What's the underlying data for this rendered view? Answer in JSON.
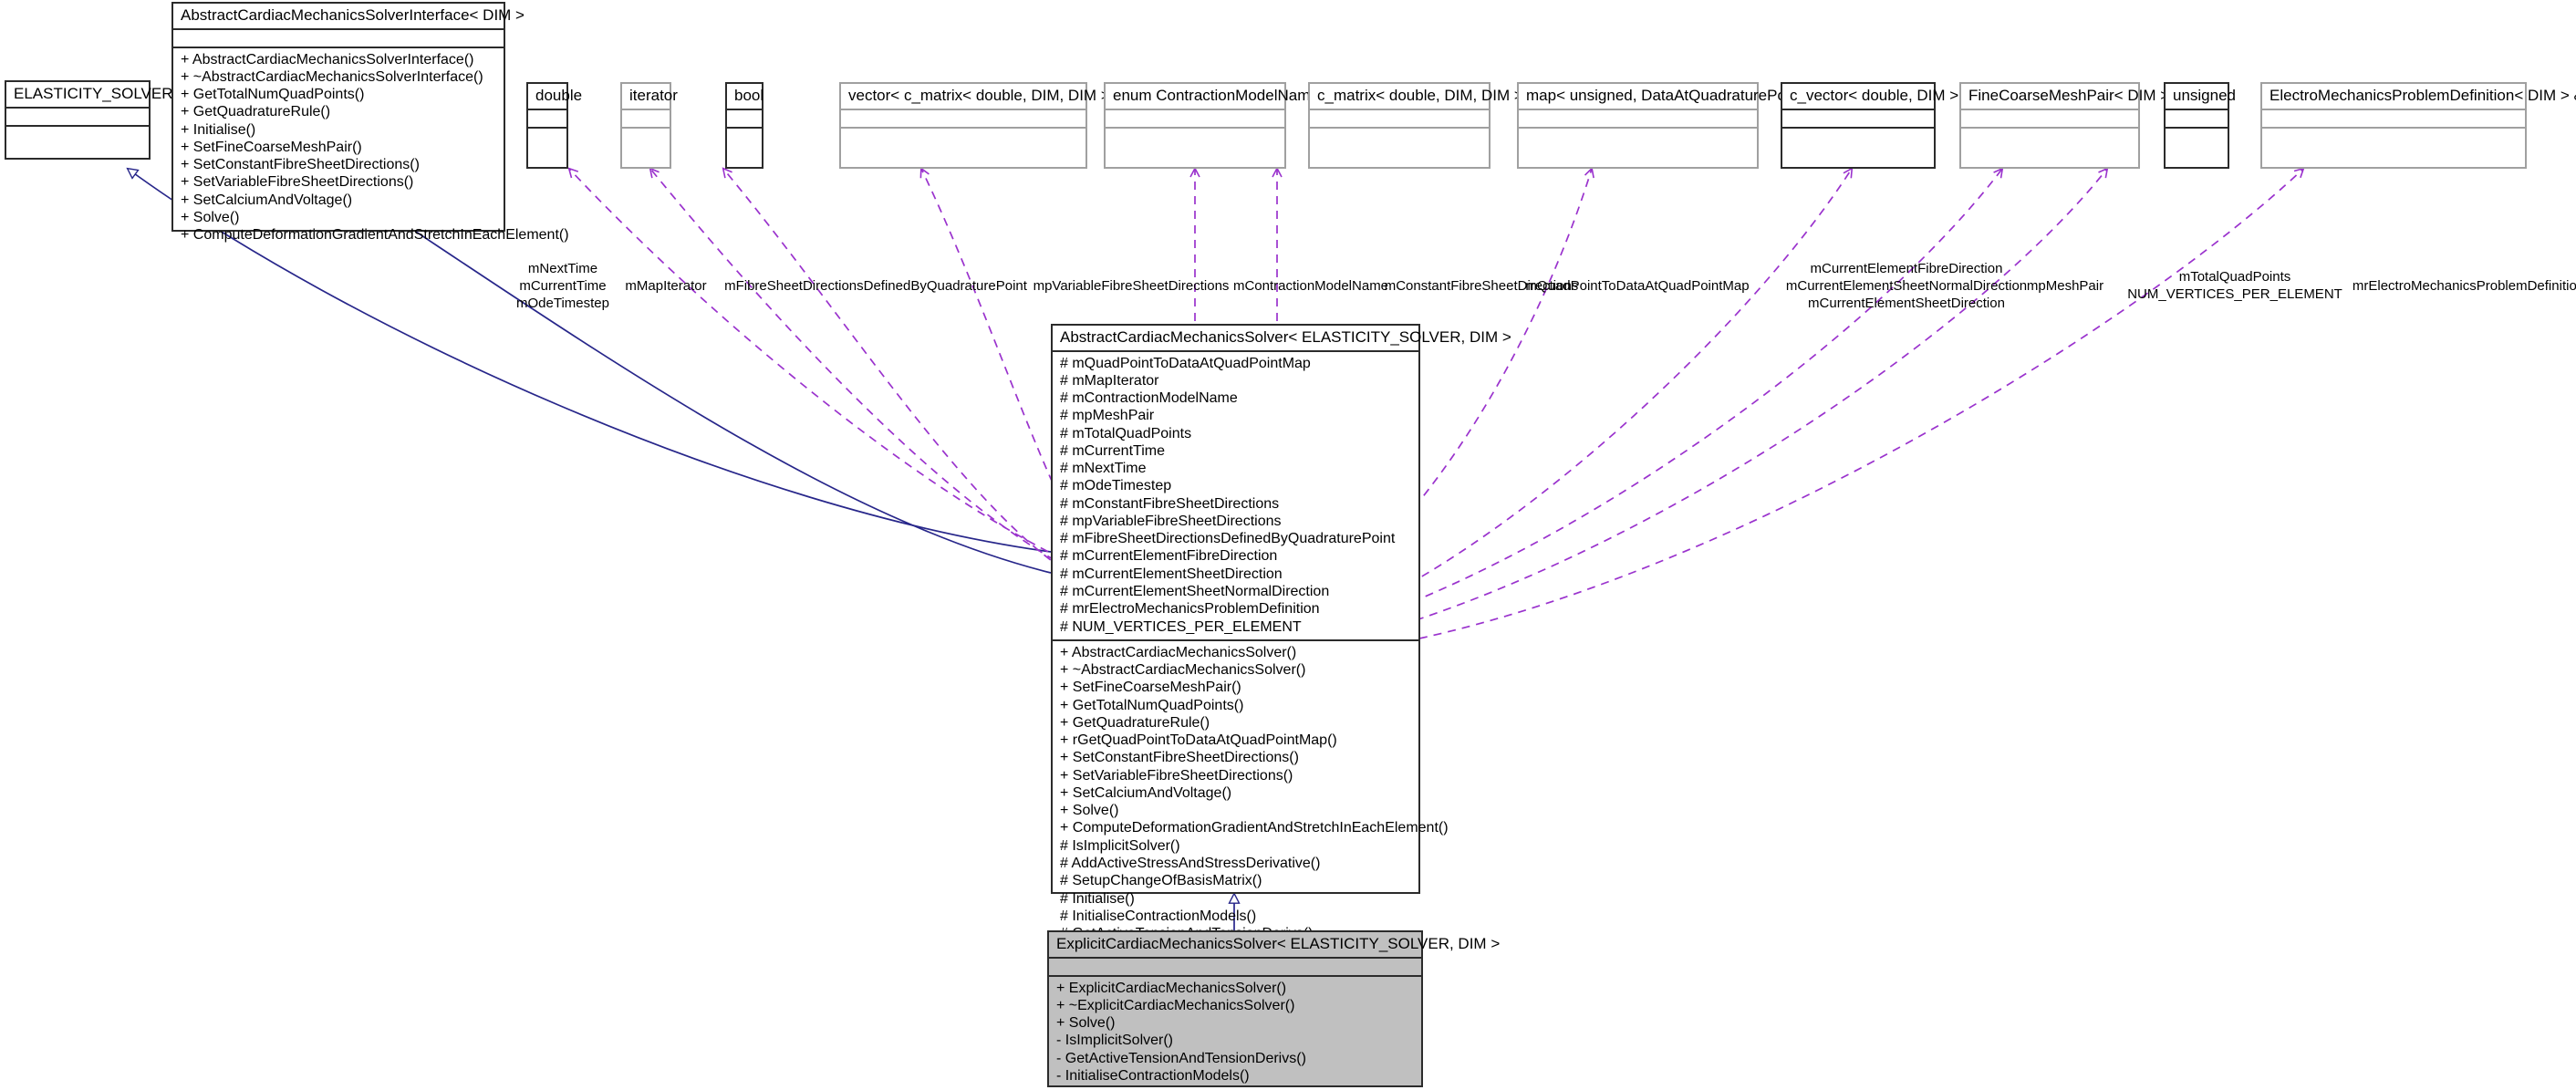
{
  "diagram": {
    "kind": "uml-class-diagram",
    "colors": {
      "inheritance_edge": "#27268a",
      "association_edge": "#9a32cd",
      "box_border_dark": "#2b2b2b",
      "box_border_light": "#a0a0a0",
      "highlight_fill": "#c0c0c0",
      "background": "#ffffff"
    }
  },
  "boxes": {
    "elasticity_solver": {
      "title": "ELASTICITY_SOLVER",
      "attributes": [],
      "methods": []
    },
    "interface": {
      "title": "AbstractCardiacMechanicsSolverInterface< DIM >",
      "attributes": [],
      "methods": [
        "+ AbstractCardiacMechanicsSolverInterface()",
        "+ ~AbstractCardiacMechanicsSolverInterface()",
        "+ GetTotalNumQuadPoints()",
        "+ GetQuadratureRule()",
        "+ Initialise()",
        "+ SetFineCoarseMeshPair()",
        "+ SetConstantFibreSheetDirections()",
        "+ SetVariableFibreSheetDirections()",
        "+ SetCalciumAndVoltage()",
        "+ Solve()",
        "+ ComputeDeformationGradientAndStretchInEachElement()"
      ]
    },
    "main": {
      "title": "AbstractCardiacMechanicsSolver< ELASTICITY_SOLVER, DIM >",
      "attributes": [
        "# mQuadPointToDataAtQuadPointMap",
        "# mMapIterator",
        "# mContractionModelName",
        "# mpMeshPair",
        "# mTotalQuadPoints",
        "# mCurrentTime",
        "# mNextTime",
        "# mOdeTimestep",
        "# mConstantFibreSheetDirections",
        "# mpVariableFibreSheetDirections",
        "# mFibreSheetDirectionsDefinedByQuadraturePoint",
        "# mCurrentElementFibreDirection",
        "# mCurrentElementSheetDirection",
        "# mCurrentElementSheetNormalDirection",
        "# mrElectroMechanicsProblemDefinition",
        "# NUM_VERTICES_PER_ELEMENT"
      ],
      "methods": [
        "+ AbstractCardiacMechanicsSolver()",
        "+ ~AbstractCardiacMechanicsSolver()",
        "+ SetFineCoarseMeshPair()",
        "+ GetTotalNumQuadPoints()",
        "+ GetQuadratureRule()",
        "+ rGetQuadPointToDataAtQuadPointMap()",
        "+ SetConstantFibreSheetDirections()",
        "+ SetVariableFibreSheetDirections()",
        "+ SetCalciumAndVoltage()",
        "+ Solve()",
        "+ ComputeDeformationGradientAndStretchInEachElement()",
        "# IsImplicitSolver()",
        "# AddActiveStressAndStressDerivative()",
        "# SetupChangeOfBasisMatrix()",
        "# Initialise()",
        "# InitialiseContractionModels()",
        "# GetActiveTensionAndTensionDerivs()"
      ]
    },
    "derived": {
      "title": "ExplicitCardiacMechanicsSolver< ELASTICITY_SOLVER, DIM >",
      "attributes": [],
      "methods": [
        "+ ExplicitCardiacMechanicsSolver()",
        "+ ~ExplicitCardiacMechanicsSolver()",
        "+ Solve()",
        "- IsImplicitSolver()",
        "- GetActiveTensionAndTensionDerivs()",
        "- InitialiseContractionModels()"
      ]
    },
    "types": [
      {
        "title": "double"
      },
      {
        "title": "iterator"
      },
      {
        "title": "bool"
      },
      {
        "title": "vector< c_matrix< double, DIM, DIM > > *"
      },
      {
        "title": "enum ContractionModelName_"
      },
      {
        "title": "c_matrix< double, DIM, DIM >"
      },
      {
        "title": "map< unsigned, DataAtQuadraturePoint >"
      },
      {
        "title": "c_vector< double, DIM >"
      },
      {
        "title": "FineCoarseMeshPair< DIM > *"
      },
      {
        "title": "unsigned"
      },
      {
        "title": "ElectroMechanicsProblemDefinition< DIM > &"
      }
    ]
  },
  "edge_labels": [
    {
      "text": "mNextTime\nmCurrentTime\nmOdeTimestep"
    },
    {
      "text": "mMapIterator"
    },
    {
      "text": "mFibreSheetDirectionsDefinedByQuadraturePoint"
    },
    {
      "text": "mpVariableFibreSheetDirections"
    },
    {
      "text": "mContractionModelName"
    },
    {
      "text": "mConstantFibreSheetDirections"
    },
    {
      "text": "mQuadPointToDataAtQuadPointMap"
    },
    {
      "text": "mCurrentElementFibreDirection\nmCurrentElementSheetNormalDirection\nmCurrentElementSheetDirection"
    },
    {
      "text": "mpMeshPair"
    },
    {
      "text": "mTotalQuadPoints\nNUM_VERTICES_PER_ELEMENT"
    },
    {
      "text": "mrElectroMechanicsProblemDefinition"
    }
  ]
}
